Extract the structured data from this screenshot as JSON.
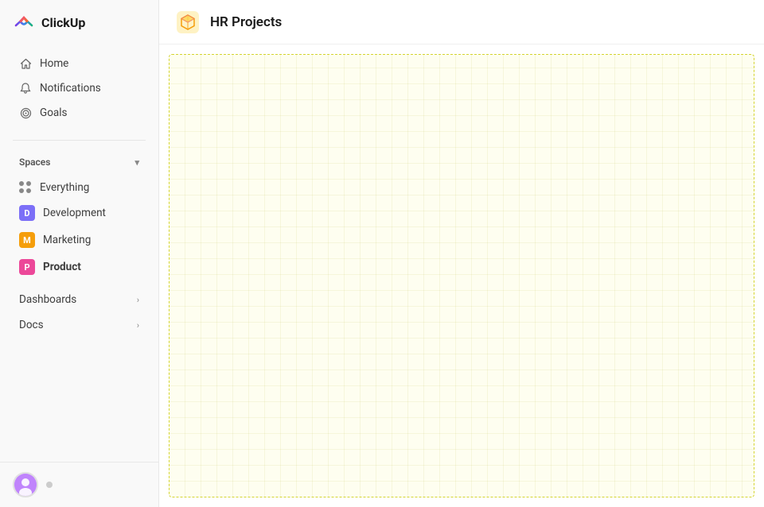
{
  "app": {
    "name": "ClickUp"
  },
  "sidebar": {
    "logo_text": "ClickUp",
    "nav_items": [
      {
        "id": "home",
        "label": "Home",
        "icon": "home-icon"
      },
      {
        "id": "notifications",
        "label": "Notifications",
        "icon": "bell-icon"
      },
      {
        "id": "goals",
        "label": "Goals",
        "icon": "target-icon"
      }
    ],
    "spaces_label": "Spaces",
    "spaces": [
      {
        "id": "everything",
        "label": "Everything",
        "type": "dots"
      },
      {
        "id": "development",
        "label": "Development",
        "color": "#7c6ff7",
        "initial": "D"
      },
      {
        "id": "marketing",
        "label": "Marketing",
        "color": "#f59e0b",
        "initial": "M"
      },
      {
        "id": "product",
        "label": "Product",
        "color": "#ec4899",
        "initial": "P",
        "active": true
      }
    ],
    "collapsibles": [
      {
        "id": "dashboards",
        "label": "Dashboards"
      },
      {
        "id": "docs",
        "label": "Docs"
      }
    ]
  },
  "main": {
    "title": "HR Projects",
    "icon": "cube-icon"
  }
}
